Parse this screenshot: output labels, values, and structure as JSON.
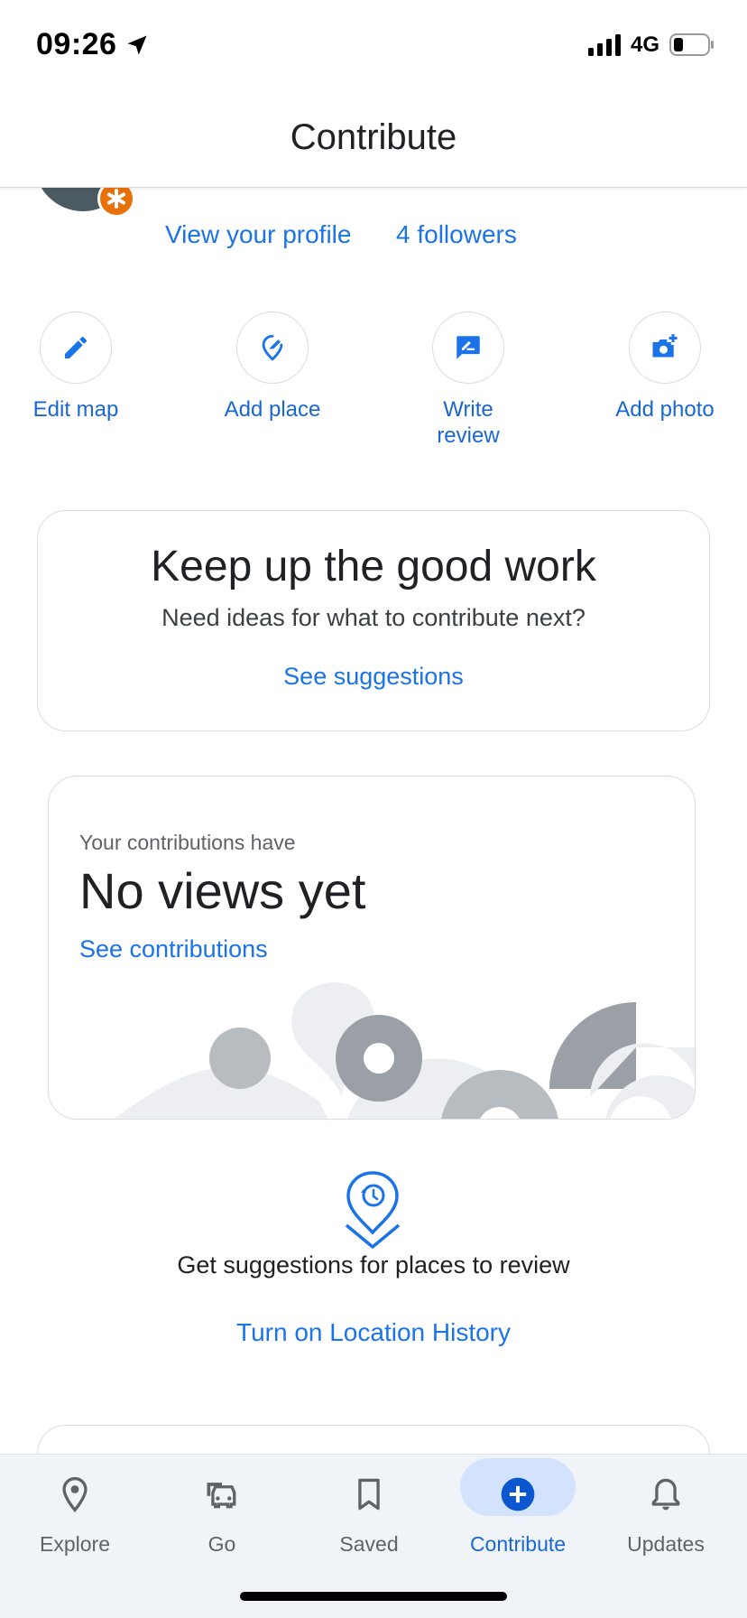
{
  "status_bar": {
    "time": "09:26",
    "network": "4G"
  },
  "header": {
    "title": "Contribute"
  },
  "profile": {
    "view_profile": "View your profile",
    "followers": "4 followers"
  },
  "quick_actions": [
    {
      "label": "Edit map",
      "icon": "pencil-icon"
    },
    {
      "label": "Add place",
      "icon": "add-place-icon"
    },
    {
      "label": "Write review",
      "icon": "write-review-icon"
    },
    {
      "label": "Add photo",
      "icon": "add-photo-icon"
    }
  ],
  "suggest_card": {
    "title": "Keep up the good work",
    "subtitle": "Need ideas for what to contribute next?",
    "link": "See suggestions"
  },
  "views_card": {
    "eyebrow": "Your contributions have",
    "title": "No views yet",
    "link": "See contributions"
  },
  "location_history": {
    "text": "Get suggestions for places to review",
    "link": "Turn on Location History"
  },
  "bottom_nav": {
    "items": [
      {
        "label": "Explore",
        "icon": "map-pin-icon"
      },
      {
        "label": "Go",
        "icon": "car-icon"
      },
      {
        "label": "Saved",
        "icon": "bookmark-icon"
      },
      {
        "label": "Contribute",
        "icon": "plus-circle-icon",
        "active": true
      },
      {
        "label": "Updates",
        "icon": "bell-icon"
      }
    ]
  },
  "colors": {
    "accent": "#1a73e8",
    "active_pill": "#d3e3fd",
    "badge": "#e8710a"
  }
}
